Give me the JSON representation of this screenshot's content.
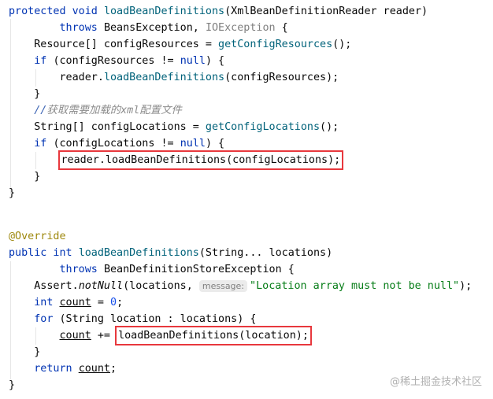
{
  "blocks": [
    {
      "lines": [
        [
          [
            "protected void ",
            "kw"
          ],
          [
            "loadBeanDefinitions",
            "fn"
          ],
          [
            "(XmlBeanDefinitionReader reader)",
            ""
          ]
        ],
        [
          [
            "        ",
            ""
          ],
          [
            "throws ",
            "kw"
          ],
          [
            "BeansException, ",
            ""
          ],
          [
            "IOException",
            "gray"
          ],
          [
            " {",
            ""
          ]
        ],
        [
          [
            "    Resource[] configResources = ",
            ""
          ],
          [
            "getConfigResources",
            "fn"
          ],
          [
            "();",
            ""
          ]
        ],
        [
          [
            "    ",
            ""
          ],
          [
            "if ",
            "kw"
          ],
          [
            "(configResources != ",
            ""
          ],
          [
            "null",
            "kw"
          ],
          [
            ") {",
            ""
          ]
        ],
        [
          [
            "        reader.",
            ""
          ],
          [
            "loadBeanDefinitions",
            "fn"
          ],
          [
            "(configResources);",
            ""
          ]
        ],
        [
          [
            "    }",
            ""
          ]
        ],
        [
          [
            "    ",
            ""
          ],
          [
            "//",
            "cms"
          ],
          [
            "获取需要加载的xml配置文件",
            "cm"
          ]
        ],
        [
          [
            "    String[] configLocations = ",
            ""
          ],
          [
            "getConfigLocations",
            "fn"
          ],
          [
            "();",
            ""
          ]
        ],
        [
          [
            "    ",
            ""
          ],
          [
            "if ",
            "kw"
          ],
          [
            "(configLocations != ",
            ""
          ],
          [
            "null",
            "kw"
          ],
          [
            ") {",
            ""
          ]
        ],
        [
          [
            "        ",
            ""
          ],
          [
            "reader.loadBeanDefinitions(configLocations);",
            "boxed"
          ]
        ],
        [
          [
            "    }",
            ""
          ]
        ],
        [
          [
            "}",
            ""
          ]
        ]
      ]
    },
    {
      "lines": [
        [
          [
            "@Override",
            "ann"
          ]
        ],
        [
          [
            "public int ",
            "kw"
          ],
          [
            "loadBeanDefinitions",
            "fn"
          ],
          [
            "(String... locations)",
            ""
          ]
        ],
        [
          [
            "        ",
            ""
          ],
          [
            "throws ",
            "kw"
          ],
          [
            "BeanDefinitionStoreException {",
            ""
          ]
        ],
        [
          [
            "    Assert.",
            ""
          ],
          [
            "notNull",
            "it"
          ],
          [
            "(locations, ",
            ""
          ],
          [
            "message:",
            "hint"
          ],
          [
            "\"Location array must not be null\"",
            "str"
          ],
          [
            ");",
            ""
          ]
        ],
        [
          [
            "    ",
            ""
          ],
          [
            "int ",
            "kw"
          ],
          [
            "count",
            "ul"
          ],
          [
            " = ",
            ""
          ],
          [
            "0",
            "num"
          ],
          [
            ";",
            ""
          ]
        ],
        [
          [
            "    ",
            ""
          ],
          [
            "for ",
            "kw"
          ],
          [
            "(String location : locations) {",
            ""
          ]
        ],
        [
          [
            "        ",
            ""
          ],
          [
            "count",
            "ul"
          ],
          [
            " += ",
            ""
          ],
          [
            "loadBeanDefinitions(location);",
            "boxed"
          ]
        ],
        [
          [
            "    }",
            ""
          ]
        ],
        [
          [
            "    ",
            ""
          ],
          [
            "return ",
            "kw"
          ],
          [
            "count",
            "ul"
          ],
          [
            ";",
            ""
          ]
        ],
        [
          [
            "}",
            ""
          ]
        ]
      ]
    }
  ],
  "watermark": "@稀土掘金技术社区"
}
